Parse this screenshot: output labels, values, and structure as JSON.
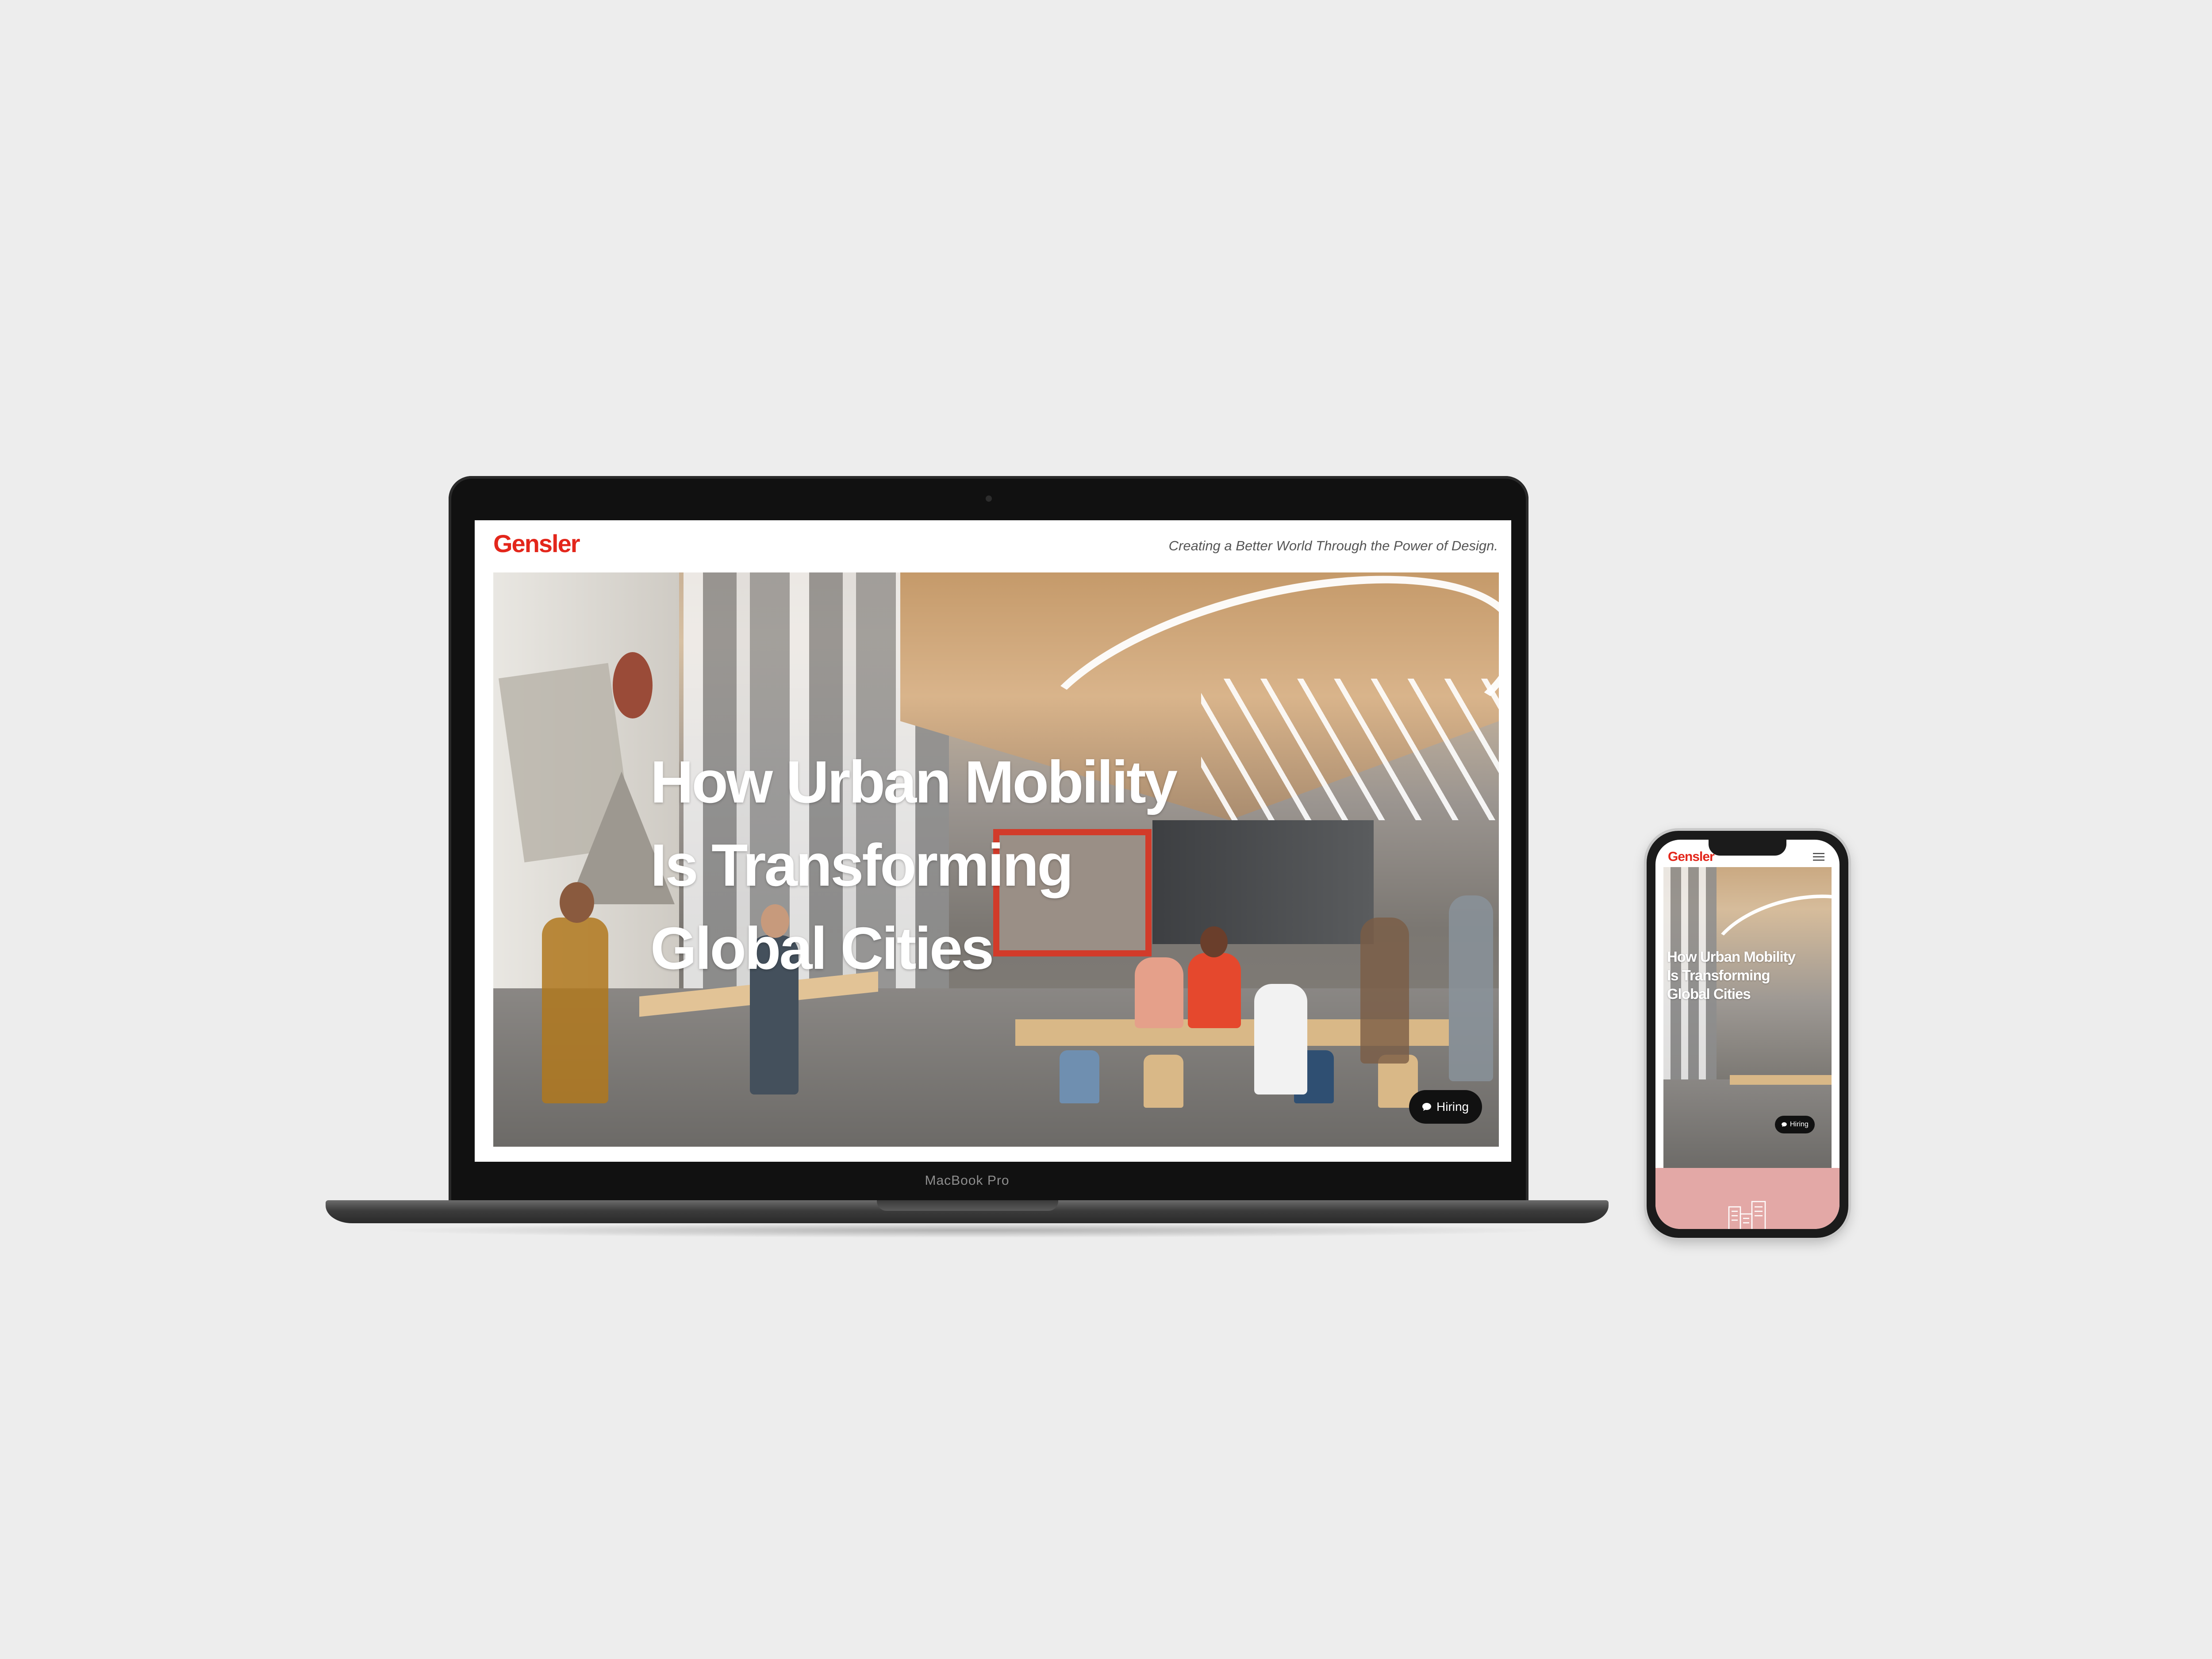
{
  "laptop": {
    "device_label": "MacBook Pro",
    "site": {
      "logo": "Gensler",
      "tagline": "Creating a Better World Through the Power of Design.",
      "hero": {
        "title_lines": [
          "How Urban Mobility",
          "Is Transforming",
          "Global Cities"
        ]
      },
      "hiring_button": {
        "label": "Hiring",
        "icon": "chat-bubble-icon"
      }
    }
  },
  "phone": {
    "site": {
      "logo": "Gensler",
      "menu_icon": "hamburger-menu-icon",
      "hero": {
        "title_lines": [
          "How Urban Mobility",
          "Is Transforming",
          "Global Cities"
        ]
      },
      "hiring_button": {
        "label": "Hiring",
        "icon": "chat-bubble-icon"
      },
      "section_icon": "building-icon"
    }
  },
  "colors": {
    "background": "#ededed",
    "brand_red": "#e3261b",
    "pink_section": "#e3a8a6",
    "pill_black": "#111111"
  }
}
